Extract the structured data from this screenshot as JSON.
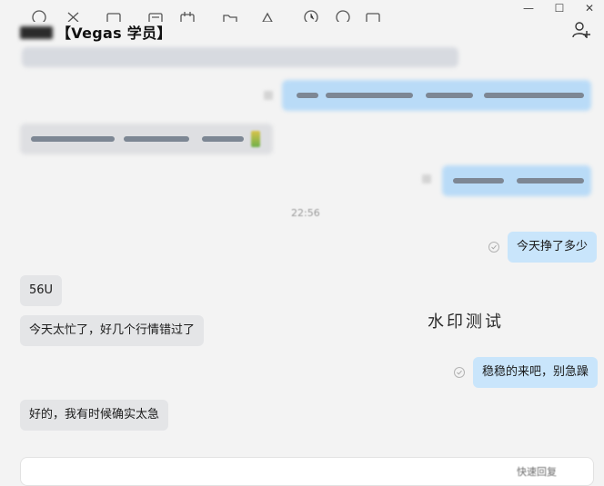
{
  "window": {
    "title_visible": "【Vegas 学员】",
    "title_masked": true,
    "controls": {
      "minimize": "—",
      "maximize": "☐",
      "close": "✕"
    }
  },
  "header": {
    "add_member_icon": "add-person-icon"
  },
  "messages": [
    {
      "id": "m1",
      "direction": "out",
      "text": "今天挣了多少",
      "status": "read-check-icon"
    },
    {
      "id": "m2",
      "direction": "in",
      "text": "56U"
    },
    {
      "id": "m3",
      "direction": "in",
      "text": "今天太忙了，好几个行情错过了"
    },
    {
      "id": "m4",
      "direction": "out",
      "text": "稳稳的来吧，别急躁",
      "status": "read-check-icon"
    },
    {
      "id": "m5",
      "direction": "in",
      "text": "好的，我有时候确实太急"
    }
  ],
  "timestamp": "22:56",
  "watermark": "水印测试",
  "composer": {
    "tools": [
      "emoji-icon",
      "scissors-icon",
      "folder-icon",
      "image-icon",
      "calendar-icon",
      "file-icon",
      "location-icon",
      "history-icon",
      "voice-call-icon",
      "video-call-icon"
    ],
    "quick_reply": "快速回复"
  },
  "colors": {
    "background": "#f3f3f3",
    "outgoing_bubble": "#c9e5fb",
    "incoming_bubble": "#e4e5e7",
    "composer": "#ffffff"
  }
}
